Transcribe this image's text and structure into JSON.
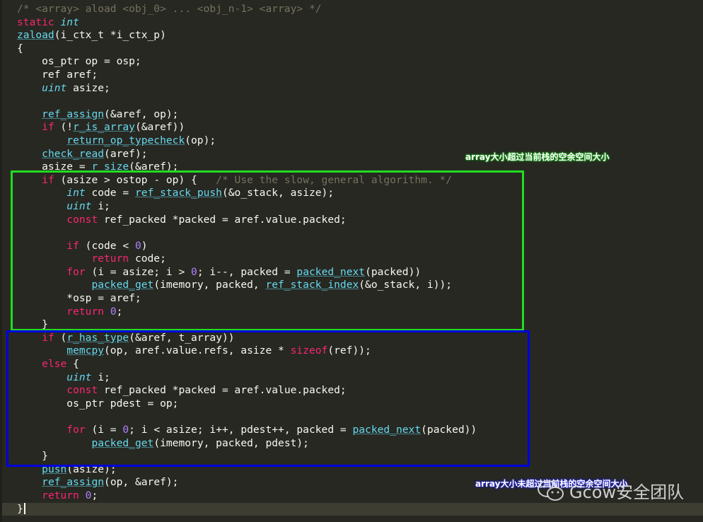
{
  "editor": {
    "lines": [
      [
        {
          "t": "/* <array> aload <obj_0> ... <obj_n-1> <array> */",
          "c": "comment"
        }
      ],
      [
        {
          "t": "static",
          "c": "kw"
        },
        {
          "t": " ",
          "c": "plain"
        },
        {
          "t": "int",
          "c": "type"
        }
      ],
      [
        {
          "t": "zaload",
          "c": "fn"
        },
        {
          "t": "(i_ctx_t *i_ctx_p)",
          "c": "plain"
        }
      ],
      [
        {
          "t": "{",
          "c": "plain"
        }
      ],
      [
        {
          "t": "    os_ptr op = osp;",
          "c": "plain"
        }
      ],
      [
        {
          "t": "    ref aref;",
          "c": "plain"
        }
      ],
      [
        {
          "t": "    ",
          "c": "plain"
        },
        {
          "t": "uint",
          "c": "type"
        },
        {
          "t": " asize;",
          "c": "plain"
        }
      ],
      [
        {
          "t": "",
          "c": "plain"
        }
      ],
      [
        {
          "t": "    ",
          "c": "plain"
        },
        {
          "t": "ref_assign",
          "c": "fn"
        },
        {
          "t": "(&aref, op);",
          "c": "plain"
        }
      ],
      [
        {
          "t": "    ",
          "c": "plain"
        },
        {
          "t": "if",
          "c": "kw"
        },
        {
          "t": " (!",
          "c": "plain"
        },
        {
          "t": "r_is_array",
          "c": "fn"
        },
        {
          "t": "(&aref))",
          "c": "plain"
        }
      ],
      [
        {
          "t": "        ",
          "c": "plain"
        },
        {
          "t": "return_op_typecheck",
          "c": "fn"
        },
        {
          "t": "(op);",
          "c": "plain"
        }
      ],
      [
        {
          "t": "    ",
          "c": "plain"
        },
        {
          "t": "check_read",
          "c": "fn"
        },
        {
          "t": "(aref);",
          "c": "plain"
        }
      ],
      [
        {
          "t": "    asize = ",
          "c": "plain"
        },
        {
          "t": "r_size",
          "c": "fn"
        },
        {
          "t": "(&aref);",
          "c": "plain"
        }
      ],
      [
        {
          "t": "    ",
          "c": "plain"
        },
        {
          "t": "if",
          "c": "kw"
        },
        {
          "t": " (asize > ostop - op) {   ",
          "c": "plain"
        },
        {
          "t": "/* Use the slow, general algorithm. */",
          "c": "comment"
        }
      ],
      [
        {
          "t": "        ",
          "c": "plain"
        },
        {
          "t": "int",
          "c": "type"
        },
        {
          "t": " code = ",
          "c": "plain"
        },
        {
          "t": "ref_stack_push",
          "c": "fn"
        },
        {
          "t": "(&o_stack, asize);",
          "c": "plain"
        }
      ],
      [
        {
          "t": "        ",
          "c": "plain"
        },
        {
          "t": "uint",
          "c": "type"
        },
        {
          "t": " i;",
          "c": "plain"
        }
      ],
      [
        {
          "t": "        ",
          "c": "plain"
        },
        {
          "t": "const",
          "c": "kw"
        },
        {
          "t": " ref_packed *packed = aref.value.packed;",
          "c": "plain"
        }
      ],
      [
        {
          "t": "",
          "c": "plain"
        }
      ],
      [
        {
          "t": "        ",
          "c": "plain"
        },
        {
          "t": "if",
          "c": "kw"
        },
        {
          "t": " (code < ",
          "c": "plain"
        },
        {
          "t": "0",
          "c": "num"
        },
        {
          "t": ")",
          "c": "plain"
        }
      ],
      [
        {
          "t": "            ",
          "c": "plain"
        },
        {
          "t": "return",
          "c": "kw"
        },
        {
          "t": " code;",
          "c": "plain"
        }
      ],
      [
        {
          "t": "        ",
          "c": "plain"
        },
        {
          "t": "for",
          "c": "kw"
        },
        {
          "t": " (i = asize; i > ",
          "c": "plain"
        },
        {
          "t": "0",
          "c": "num"
        },
        {
          "t": "; i--, packed = ",
          "c": "plain"
        },
        {
          "t": "packed_next",
          "c": "fn"
        },
        {
          "t": "(packed))",
          "c": "plain"
        }
      ],
      [
        {
          "t": "            ",
          "c": "plain"
        },
        {
          "t": "packed_get",
          "c": "fn"
        },
        {
          "t": "(imemory, packed, ",
          "c": "plain"
        },
        {
          "t": "ref_stack_index",
          "c": "fn"
        },
        {
          "t": "(&o_stack, i));",
          "c": "plain"
        }
      ],
      [
        {
          "t": "        *osp = aref;",
          "c": "plain"
        }
      ],
      [
        {
          "t": "        ",
          "c": "plain"
        },
        {
          "t": "return",
          "c": "kw"
        },
        {
          "t": " ",
          "c": "plain"
        },
        {
          "t": "0",
          "c": "num"
        },
        {
          "t": ";",
          "c": "plain"
        }
      ],
      [
        {
          "t": "    }",
          "c": "plain"
        }
      ],
      [
        {
          "t": "    ",
          "c": "plain"
        },
        {
          "t": "if",
          "c": "kw"
        },
        {
          "t": " (",
          "c": "plain"
        },
        {
          "t": "r_has_type",
          "c": "fn"
        },
        {
          "t": "(&aref, t_array))",
          "c": "plain"
        }
      ],
      [
        {
          "t": "        ",
          "c": "plain"
        },
        {
          "t": "memcpy",
          "c": "fn"
        },
        {
          "t": "(op, aref.value.refs, asize * ",
          "c": "plain"
        },
        {
          "t": "sizeof",
          "c": "kw"
        },
        {
          "t": "(ref));",
          "c": "plain"
        }
      ],
      [
        {
          "t": "    ",
          "c": "plain"
        },
        {
          "t": "else",
          "c": "kw"
        },
        {
          "t": " {",
          "c": "plain"
        }
      ],
      [
        {
          "t": "        ",
          "c": "plain"
        },
        {
          "t": "uint",
          "c": "type"
        },
        {
          "t": " i;",
          "c": "plain"
        }
      ],
      [
        {
          "t": "        ",
          "c": "plain"
        },
        {
          "t": "const",
          "c": "kw"
        },
        {
          "t": " ref_packed *packed = aref.value.packed;",
          "c": "plain"
        }
      ],
      [
        {
          "t": "        os_ptr pdest = op;",
          "c": "plain"
        }
      ],
      [
        {
          "t": "",
          "c": "plain"
        }
      ],
      [
        {
          "t": "        ",
          "c": "plain"
        },
        {
          "t": "for",
          "c": "kw"
        },
        {
          "t": " (i = ",
          "c": "plain"
        },
        {
          "t": "0",
          "c": "num"
        },
        {
          "t": "; i < asize; i++, pdest++, packed = ",
          "c": "plain"
        },
        {
          "t": "packed_next",
          "c": "fn"
        },
        {
          "t": "(packed))",
          "c": "plain"
        }
      ],
      [
        {
          "t": "            ",
          "c": "plain"
        },
        {
          "t": "packed_get",
          "c": "fn"
        },
        {
          "t": "(imemory, packed, pdest);",
          "c": "plain"
        }
      ],
      [
        {
          "t": "    }",
          "c": "plain"
        }
      ],
      [
        {
          "t": "    ",
          "c": "plain"
        },
        {
          "t": "push",
          "c": "fn"
        },
        {
          "t": "(asize);",
          "c": "plain"
        }
      ],
      [
        {
          "t": "    ",
          "c": "plain"
        },
        {
          "t": "ref_assign",
          "c": "fn"
        },
        {
          "t": "(op, &aref);",
          "c": "plain"
        }
      ],
      [
        {
          "t": "    ",
          "c": "plain"
        },
        {
          "t": "return",
          "c": "kw"
        },
        {
          "t": " ",
          "c": "plain"
        },
        {
          "t": "0",
          "c": "num"
        },
        {
          "t": ";",
          "c": "plain"
        }
      ],
      [
        {
          "t": "}",
          "c": "plain"
        }
      ]
    ],
    "cursor_line": 38
  },
  "annotations": {
    "green_note": "array大小超过当前栈的空余空间大小",
    "blue_note": "array大小未超过当前栈的空余空间大小",
    "green_color": "#22dd22",
    "blue_color": "#0000e0"
  },
  "watermark": {
    "text": "Gcow安全团队",
    "icon": "wechat-icon"
  },
  "theme": {
    "background": "#272822",
    "comment": "#75715e",
    "keyword": "#f92672",
    "type": "#66d9ef",
    "function": "#66d9ef",
    "number": "#ae81ff",
    "text": "#f8f8f2"
  }
}
